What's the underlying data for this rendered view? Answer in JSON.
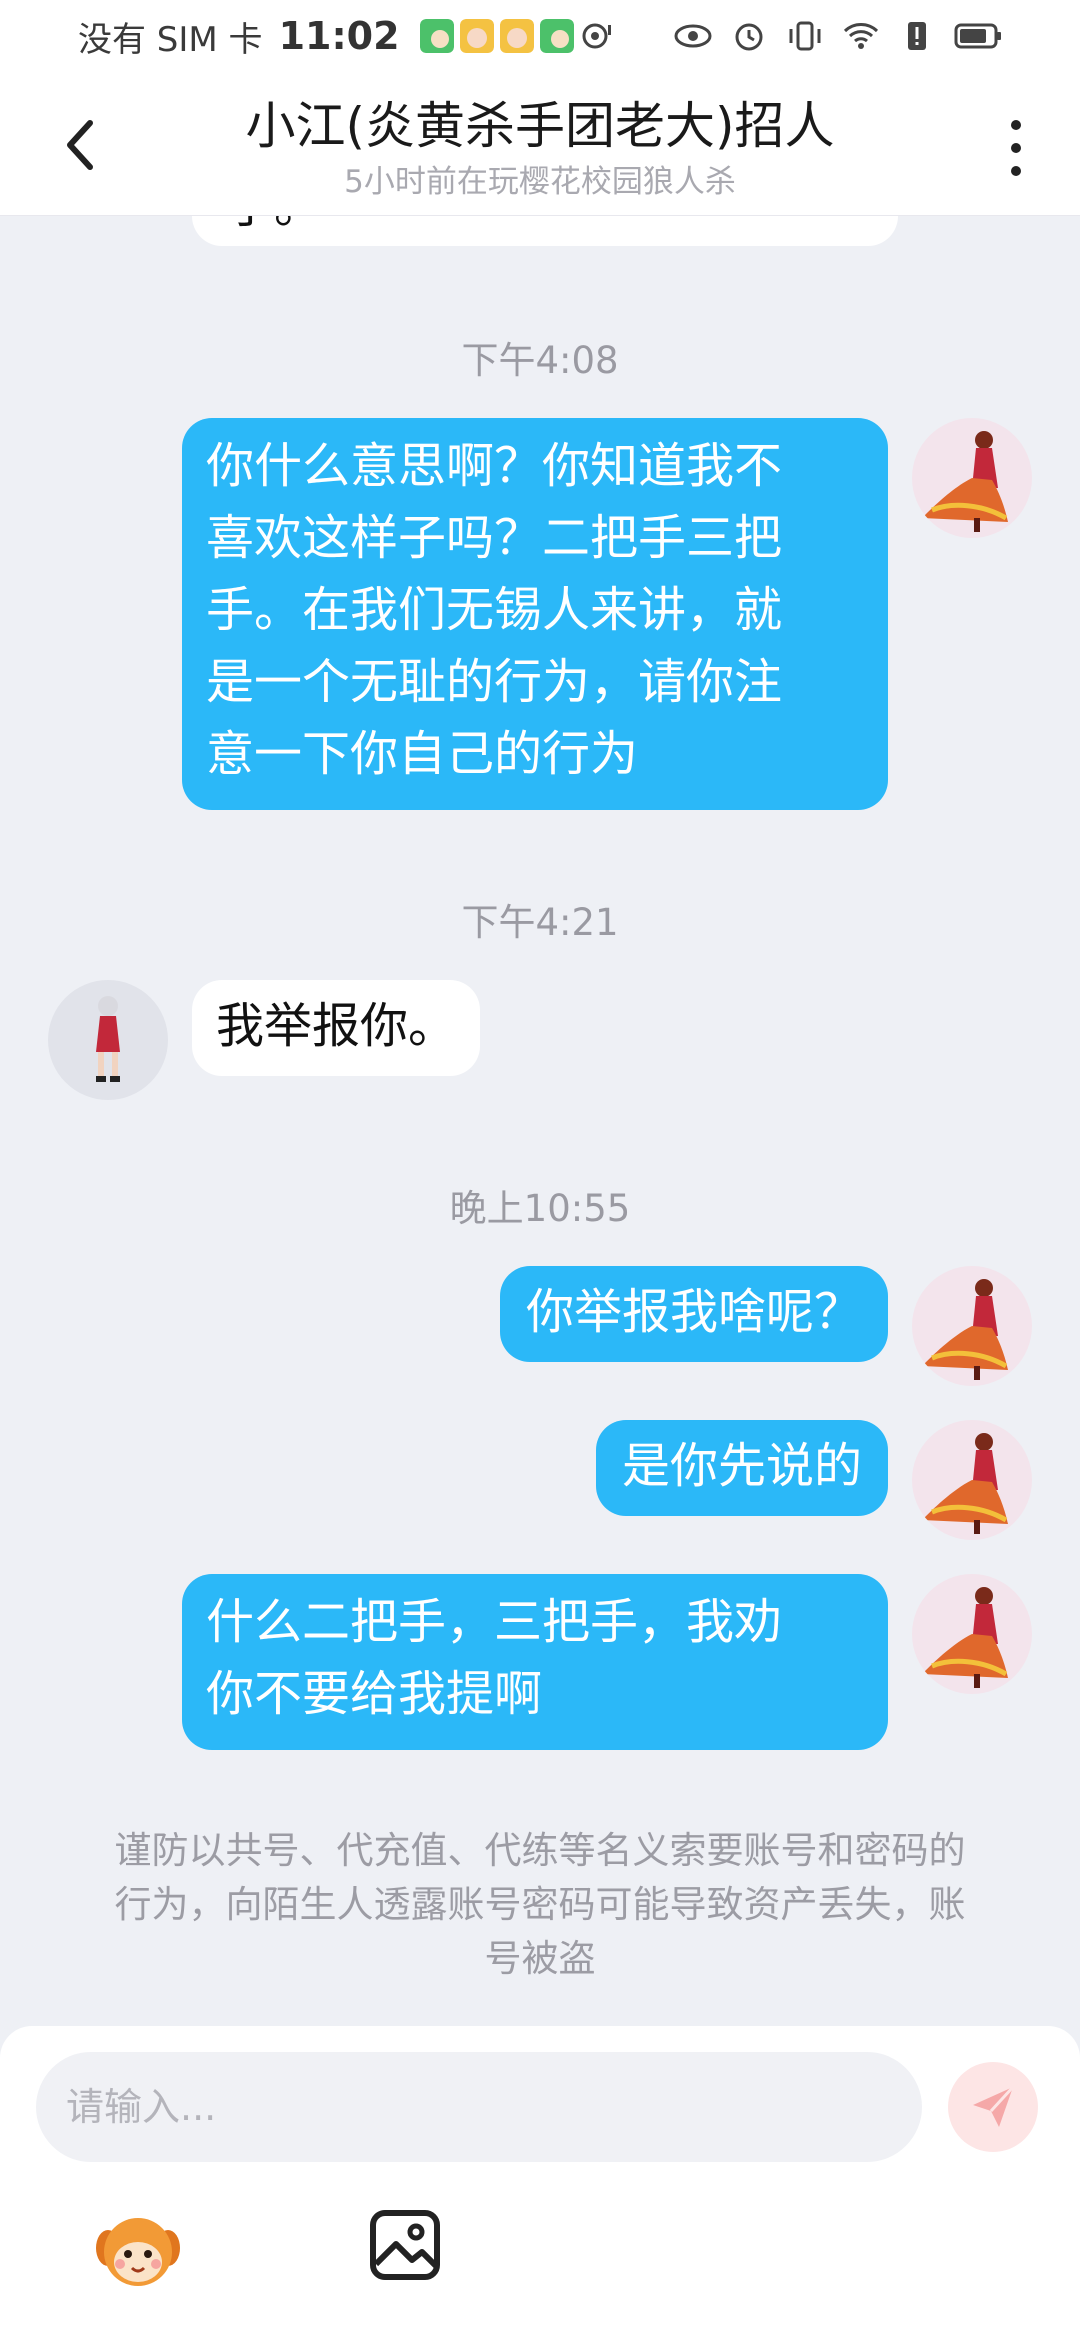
{
  "status_bar": {
    "carrier": "没有 SIM 卡",
    "time": "11:02",
    "icons": [
      "app-notification-icon",
      "app-notification-icon",
      "app-notification-icon",
      "app-notification-icon",
      "location-icon",
      "eye-icon",
      "alarm-icon",
      "vibrate-icon",
      "wifi-icon",
      "sim-alert-icon",
      "battery-icon"
    ]
  },
  "header": {
    "title": "小江(炎黄杀手团老大)招人",
    "subtitle": "5小时前在玩樱花校园狼人杀",
    "back_icon": "chevron-left-icon",
    "more_icon": "more-vertical-icon"
  },
  "chat": {
    "previous_fragment": "了。",
    "groups": [
      {
        "time": "下午4:08",
        "messages": [
          {
            "side": "out",
            "lines": [
              "你什么意思啊？你知道我不",
              "喜欢这样子吗？二把手三把",
              "手。在我们无锡人来讲，就",
              "是一个无耻的行为，请你注",
              "意一下你自己的行为"
            ]
          }
        ]
      },
      {
        "time": "下午4:21",
        "messages": [
          {
            "side": "in",
            "lines": [
              "我举报你。"
            ]
          }
        ]
      },
      {
        "time": "晚上10:55",
        "messages": [
          {
            "side": "out",
            "lines": [
              "你举报我啥呢？"
            ]
          },
          {
            "side": "out",
            "lines": [
              "是你先说的"
            ]
          },
          {
            "side": "out",
            "lines": [
              "什么二把手，三把手，我劝",
              "你不要给我提啊"
            ]
          }
        ]
      }
    ],
    "notice": "谨防以共号、代充值、代练等名义索要账号和密码的行为，向陌生人透露账号密码可能导致资产丢失，账号被盗"
  },
  "input": {
    "placeholder": "请输入...",
    "value": "",
    "send_icon": "send-icon",
    "tools": [
      "emoji-icon",
      "image-icon"
    ]
  },
  "colors": {
    "outgoing_bubble": "#2bb8f8",
    "incoming_bubble": "#ffffff",
    "chat_background": "#eef0f5",
    "send_button_disabled": "#fde5e5",
    "send_icon": "#f5a8a8"
  }
}
